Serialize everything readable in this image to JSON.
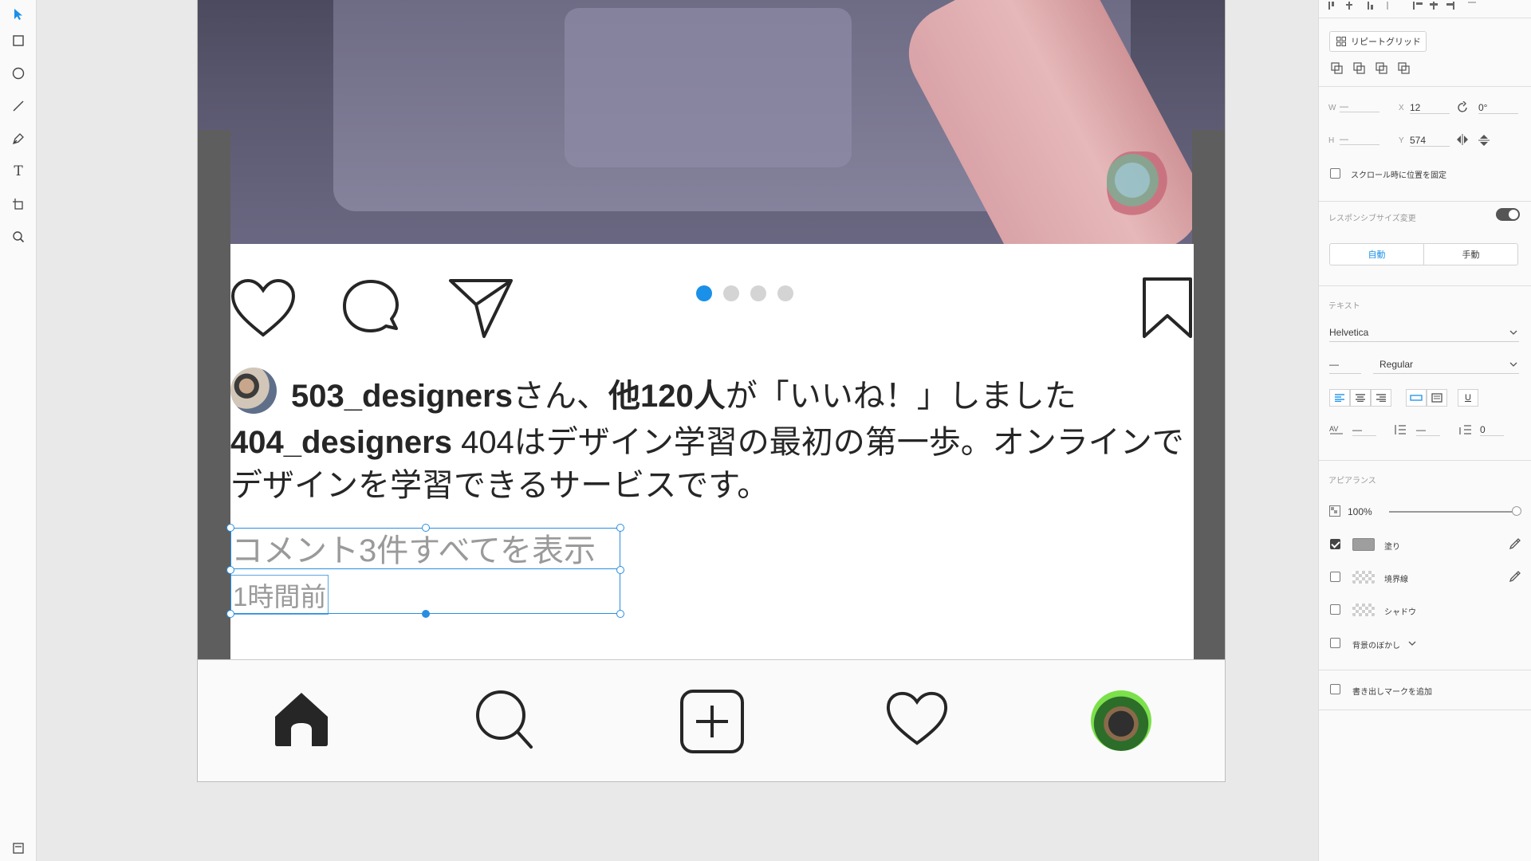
{
  "toolbar": {
    "tools": [
      {
        "name": "select-tool",
        "icon": "arrow-pointer-icon"
      },
      {
        "name": "rectangle-tool",
        "icon": "rectangle-icon"
      },
      {
        "name": "ellipse-tool",
        "icon": "ellipse-icon"
      },
      {
        "name": "line-tool",
        "icon": "line-icon"
      },
      {
        "name": "pen-tool",
        "icon": "pen-icon"
      },
      {
        "name": "text-tool",
        "icon": "text-icon"
      },
      {
        "name": "artboard-tool",
        "icon": "artboard-icon"
      },
      {
        "name": "zoom-tool",
        "icon": "zoom-icon"
      }
    ],
    "text_tool_glyph": "T",
    "accent": "#1a90e8"
  },
  "post": {
    "likes": {
      "user": "503_designers",
      "mid": "さん、",
      "count": "他120人",
      "suffix": "が「いいね！」しました"
    },
    "caption": {
      "user": "404_designers",
      "text": " 404はデザイン学習の最初の第一歩。オンラインでデザインを学習できるサービスです。"
    },
    "view_comments": "コメント3件すべてを表示",
    "time_ago": "1時間前",
    "carousel": {
      "count": 4,
      "active": 0,
      "active_color": "#1a90e8",
      "inactive_color": "#d4d4d4"
    }
  },
  "bottom_nav": {
    "items": [
      "home-icon",
      "search-icon",
      "add-post-icon",
      "heart-icon",
      "profile-avatar"
    ]
  },
  "panel": {
    "repeat_grid": "リピートグリッド",
    "w_label": "W",
    "w_value": "—",
    "h_label": "H",
    "h_value": "—",
    "x_label": "X",
    "x_value": "12",
    "y_label": "Y",
    "y_value": "574",
    "rotation": "0°",
    "fix_on_scroll": "スクロール時に位置を固定",
    "responsive_resize": "レスポンシブサイズ変更",
    "responsive_on": true,
    "auto": "自動",
    "manual": "手動",
    "text_section": "テキスト",
    "font_family": "Helvetica",
    "font_size": "—",
    "font_weight": "Regular",
    "char_spacing": "—",
    "line_spacing": "—",
    "paragraph_spacing": "0",
    "underline_glyph": "U",
    "appearance_section": "アピアランス",
    "opacity": "100%",
    "fill": {
      "label": "塗り",
      "checked": true,
      "color": "#9e9e9e"
    },
    "border": {
      "label": "境界線",
      "checked": false
    },
    "shadow": {
      "label": "シャドウ",
      "checked": false
    },
    "bg_blur": {
      "label": "背景のぼかし",
      "checked": false
    },
    "add_export_mark": "書き出しマークを追加"
  }
}
